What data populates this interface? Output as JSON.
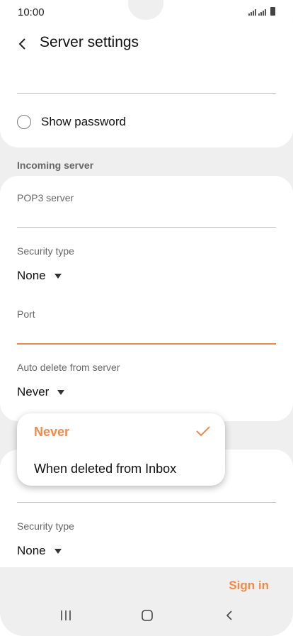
{
  "status_bar": {
    "time": "10:00"
  },
  "header": {
    "title": "Server settings"
  },
  "password": {
    "show_password_label": "Show password"
  },
  "incoming_server": {
    "section_label": "Incoming server",
    "pop3_label": "POP3 server",
    "pop3_value": "",
    "security_type_label": "Security type",
    "security_type_value": "None",
    "port_label": "Port",
    "port_value": "",
    "auto_delete_label": "Auto delete from server",
    "auto_delete_value": "Never"
  },
  "auto_delete_menu": {
    "options": [
      "Never",
      "When deleted from Inbox"
    ],
    "selected": "Never"
  },
  "outgoing_server": {
    "security_type_label": "Security type",
    "security_type_value": "None"
  },
  "footer": {
    "sign_in_label": "Sign in"
  },
  "colors": {
    "accent": "#f08a4b",
    "background": "#efefef",
    "card": "#ffffff"
  },
  "icons": [
    "signal-icon",
    "battery-icon",
    "back-arrow-icon",
    "radio-unchecked-icon",
    "dropdown-triangle-icon",
    "checkmark-icon",
    "recent-apps-icon",
    "home-icon",
    "nav-back-icon"
  ]
}
